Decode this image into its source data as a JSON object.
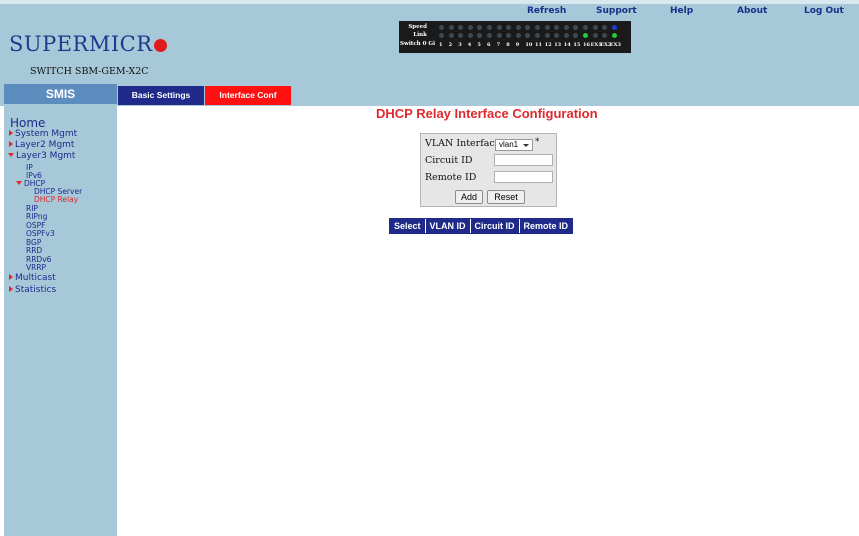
{
  "top_links": {
    "refresh": "Refresh",
    "support": "Support",
    "help": "Help",
    "about": "About",
    "logout": "Log Out"
  },
  "brand": {
    "logo_text": "SUPERMICR",
    "model": "SWITCH SBM-GEM-X2C"
  },
  "port_panel": {
    "speed_label": "Speed",
    "link_label": "Link",
    "switch_label": "Switch 0 Gi",
    "ports": [
      "1",
      "2",
      "3",
      "4",
      "5",
      "6",
      "7",
      "8",
      "9",
      "10",
      "11",
      "12",
      "13",
      "14",
      "15",
      "16",
      "EX1",
      "EX2",
      "EX3"
    ],
    "speed_on": [],
    "link_on": [
      "16",
      "EX3"
    ],
    "colors": {
      "off": "#3c4a58",
      "green": "#22c93a",
      "blue": "#1d3cc9"
    }
  },
  "nav_bar": {
    "smis": "SMIS",
    "tabs": [
      "Basic Settings",
      "Interface Conf"
    ],
    "active_tab": "Interface Conf"
  },
  "sidebar": {
    "home": "Home",
    "items": [
      {
        "label": "System Mgmt",
        "level": 1,
        "state": "collapsed"
      },
      {
        "label": "Layer2 Mgmt",
        "level": 1,
        "state": "collapsed"
      },
      {
        "label": "Layer3 Mgmt",
        "level": 1,
        "state": "expanded"
      },
      {
        "label": "IP",
        "level": 2
      },
      {
        "label": "IPv6",
        "level": 2
      },
      {
        "label": "DHCP",
        "level": 2,
        "state": "expanded"
      },
      {
        "label": "DHCP Server",
        "level": 3
      },
      {
        "label": "DHCP Relay",
        "level": 3,
        "active": true
      },
      {
        "label": "RIP",
        "level": 2
      },
      {
        "label": "RIPng",
        "level": 2
      },
      {
        "label": "OSPF",
        "level": 2
      },
      {
        "label": "OSPFv3",
        "level": 2
      },
      {
        "label": "BGP",
        "level": 2
      },
      {
        "label": "RRD",
        "level": 2
      },
      {
        "label": "RRDv6",
        "level": 2
      },
      {
        "label": "VRRP",
        "level": 2
      },
      {
        "label": "Multicast",
        "level": 1,
        "state": "collapsed"
      },
      {
        "label": "Statistics",
        "level": 1,
        "state": "collapsed"
      }
    ]
  },
  "main": {
    "title": "DHCP Relay Interface Configuration",
    "form": {
      "vlan_label": "VLAN Interface",
      "vlan_value": "vlan1",
      "required_mark": "*",
      "circuit_label": "Circuit ID",
      "circuit_value": "",
      "remote_label": "Remote ID",
      "remote_value": "",
      "add_button": "Add",
      "reset_button": "Reset"
    },
    "table": {
      "headers": [
        "Select",
        "VLAN ID",
        "Circuit ID",
        "Remote ID"
      ]
    }
  },
  "colors": {
    "header_bg": "#a6c8d9",
    "accent_red": "#e0282d",
    "nav_blue": "#1f2a8a"
  }
}
